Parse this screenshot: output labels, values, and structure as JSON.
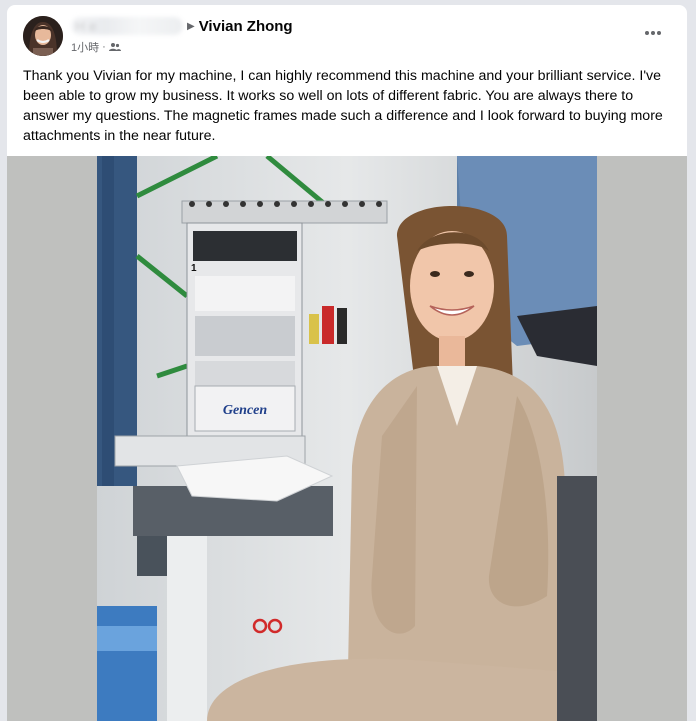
{
  "post": {
    "author_hidden_name": "H e",
    "target_name": "Vivian Zhong",
    "time": "1小時",
    "text": "Thank you Vivian for my machine, I can highly recommend this machine and your brilliant service. I've been able to grow my business.  It works so well on lots of different fabric.  You are always there to answer my questions.  The magnetic frames made such a difference and I look forward to buying more attachments in the near future.",
    "audience_icon": "friends-icon",
    "more_icon": "more-options-icon"
  },
  "photo": {
    "machine_brand": "Gencen",
    "head_number": "1"
  },
  "colors": {
    "page_bg": "#e4e6eb",
    "card_bg": "#ffffff",
    "text": "#050505",
    "secondary_text": "#65676b",
    "photo_bg": "#bfc0be"
  }
}
